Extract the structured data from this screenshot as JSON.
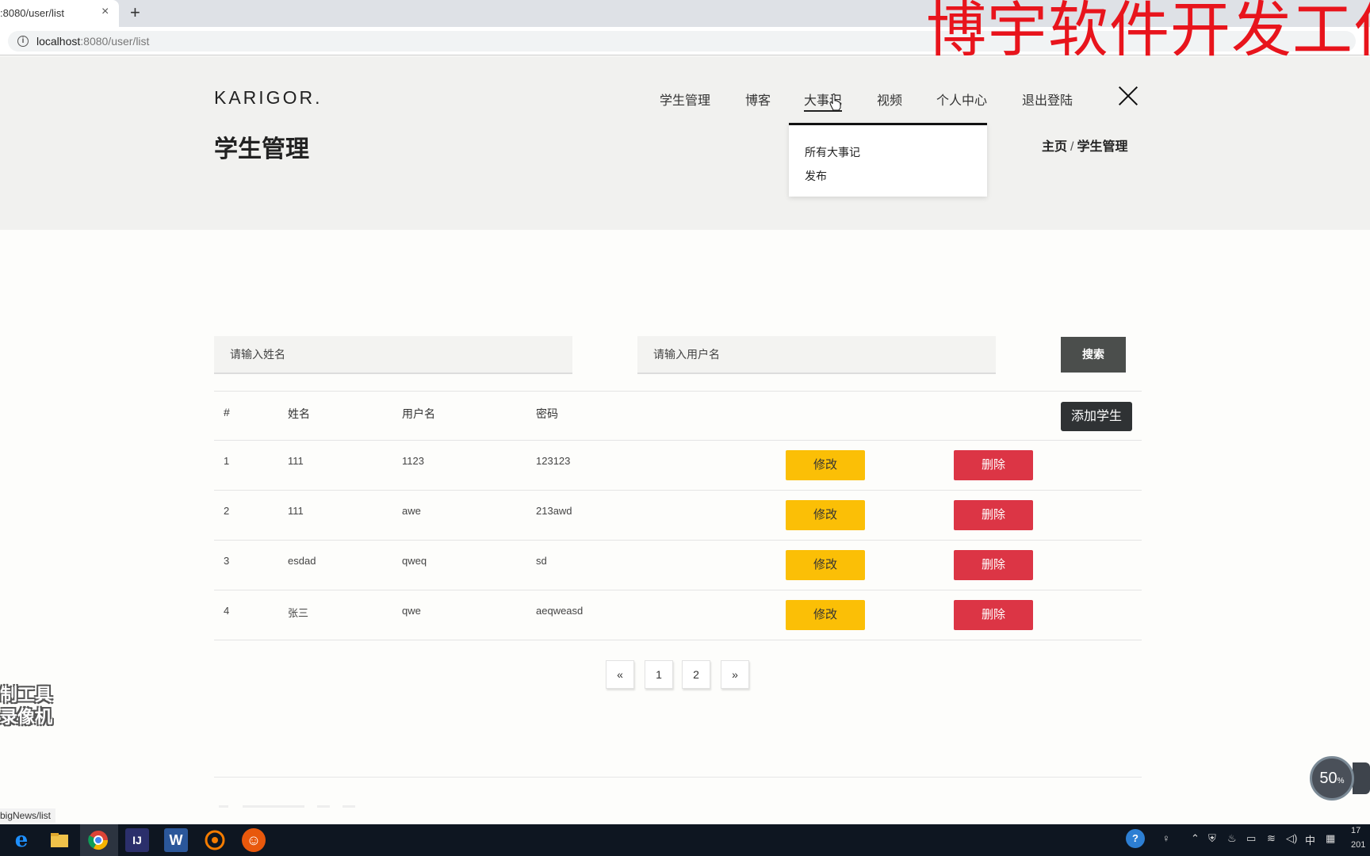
{
  "browser": {
    "tab_title": ":8080/user/list",
    "tab_close": "×",
    "new_tab": "+",
    "address_host": "localhost",
    "address_rest": ":8080/user/list",
    "status_url": "bigNews/list"
  },
  "watermark": "博宇软件开发工作",
  "header": {
    "logo": "KARIGOR.",
    "nav": [
      "学生管理",
      "博客",
      "大事记",
      "视频",
      "个人中心",
      "退出登陆"
    ],
    "active_nav_index": 2,
    "page_title": "学生管理",
    "breadcrumb": {
      "home": "主页",
      "separator": "/",
      "current": "学生管理"
    }
  },
  "dropdown": {
    "items": [
      "所有大事记",
      "发布"
    ]
  },
  "search": {
    "name_placeholder": "请输入姓名",
    "username_placeholder": "请输入用户名",
    "button": "搜索"
  },
  "table": {
    "headers": [
      "#",
      "姓名",
      "用户名",
      "密码"
    ],
    "add_button": "添加学生",
    "edit_label": "修改",
    "delete_label": "删除",
    "rows": [
      [
        "1",
        "111",
        "1123",
        "123123"
      ],
      [
        "2",
        "111",
        "awe",
        "213awd"
      ],
      [
        "3",
        "esdad",
        "qweq",
        "sd"
      ],
      [
        "4",
        "张三",
        "qwe",
        "aeqweasd"
      ]
    ]
  },
  "pagination": [
    "«",
    "1",
    "2",
    "»"
  ],
  "overlay": {
    "recorder_logo": [
      "制工具",
      "录像机"
    ],
    "zoom": "50",
    "zoom_unit": "%"
  },
  "tray": {
    "ime": "中",
    "clock_top": "17",
    "clock_bottom": "201"
  },
  "colors": {
    "edit": "#fbbf06",
    "delete": "#dc3545",
    "search_button": "#4b4e4c",
    "add_button": "#2f3234",
    "watermark": "#e8141c"
  }
}
